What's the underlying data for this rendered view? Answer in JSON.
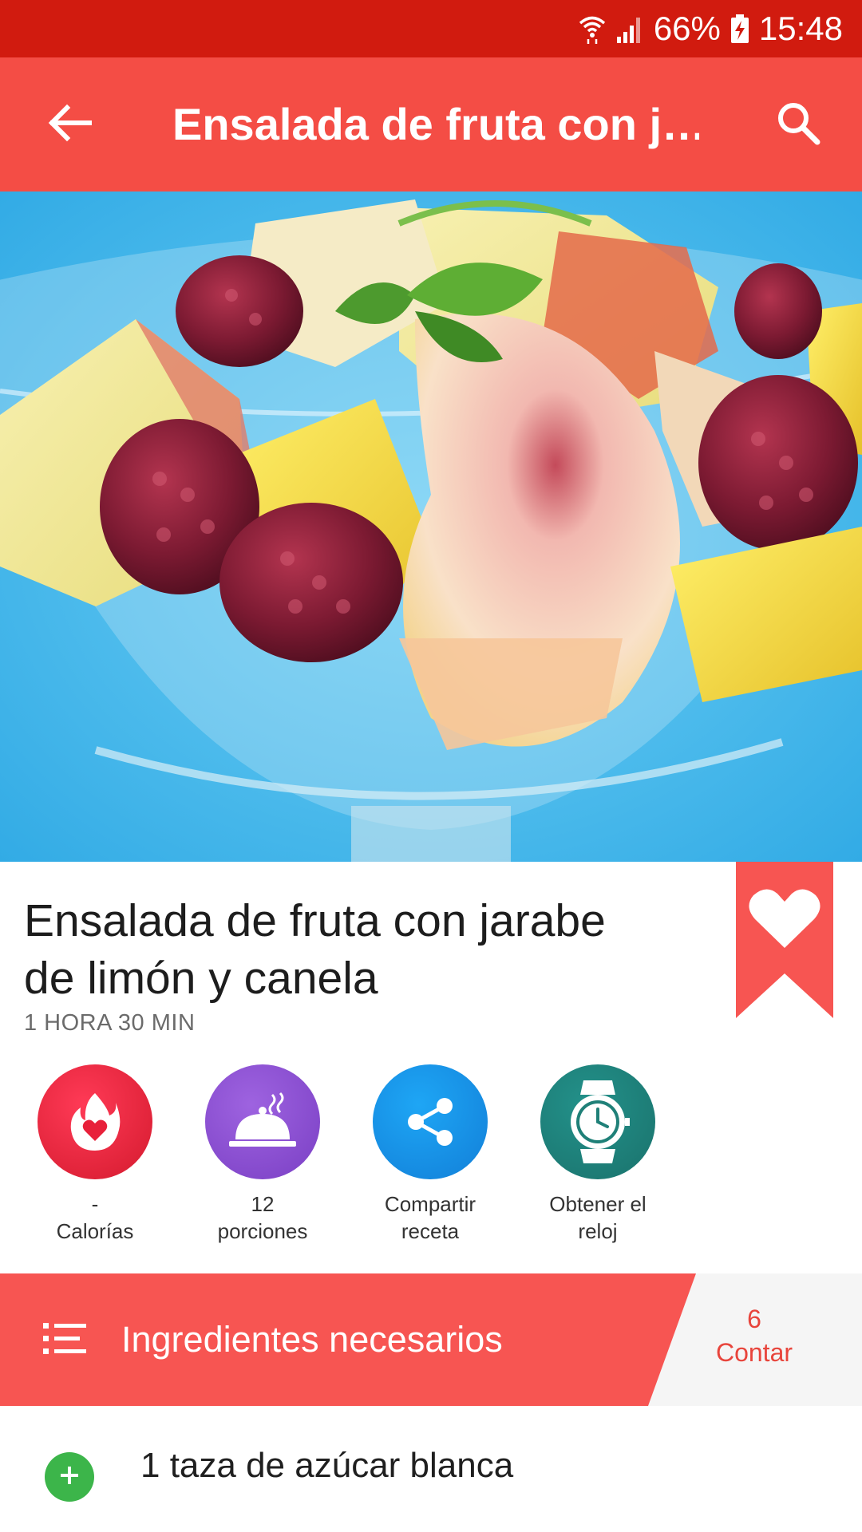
{
  "status_bar": {
    "battery": "66%",
    "time": "15:48",
    "icons": [
      "wifi-icon",
      "signal-icon",
      "battery-charging-icon"
    ]
  },
  "app_bar": {
    "title": "Ensalada de fruta con j…",
    "back_icon": "arrow-left-icon",
    "search_icon": "search-icon"
  },
  "hero": {
    "image": "fruit-salad-photo"
  },
  "recipe": {
    "title": "Ensalada de fruta con jarabe de limón y canela",
    "time": "1 HORA 30 MIN",
    "favorite_icon": "heart-bookmark-icon"
  },
  "actions": [
    {
      "line1": "-",
      "line2": "Calorías",
      "icon": "flame-heart-icon",
      "color": "#e8203a"
    },
    {
      "line1": "12",
      "line2": "porciones",
      "icon": "serving-dish-icon",
      "color": "#8a4fd0"
    },
    {
      "line1": "Compartir",
      "line2": "receta",
      "icon": "share-icon",
      "color": "#1a8ee8"
    },
    {
      "line1": "Obtener el",
      "line2": "reloj",
      "icon": "watch-icon",
      "color": "#1f8078"
    }
  ],
  "ingredients": {
    "header": "Ingredientes necesarios",
    "count": "6",
    "count_label": "Contar",
    "items": [
      {
        "text": "1 taza de azúcar blanca",
        "icon": "plus-icon"
      }
    ]
  },
  "colors": {
    "status_bar": "#d11b0f",
    "primary": "#f44d45",
    "accent_green": "#3cb54a"
  }
}
